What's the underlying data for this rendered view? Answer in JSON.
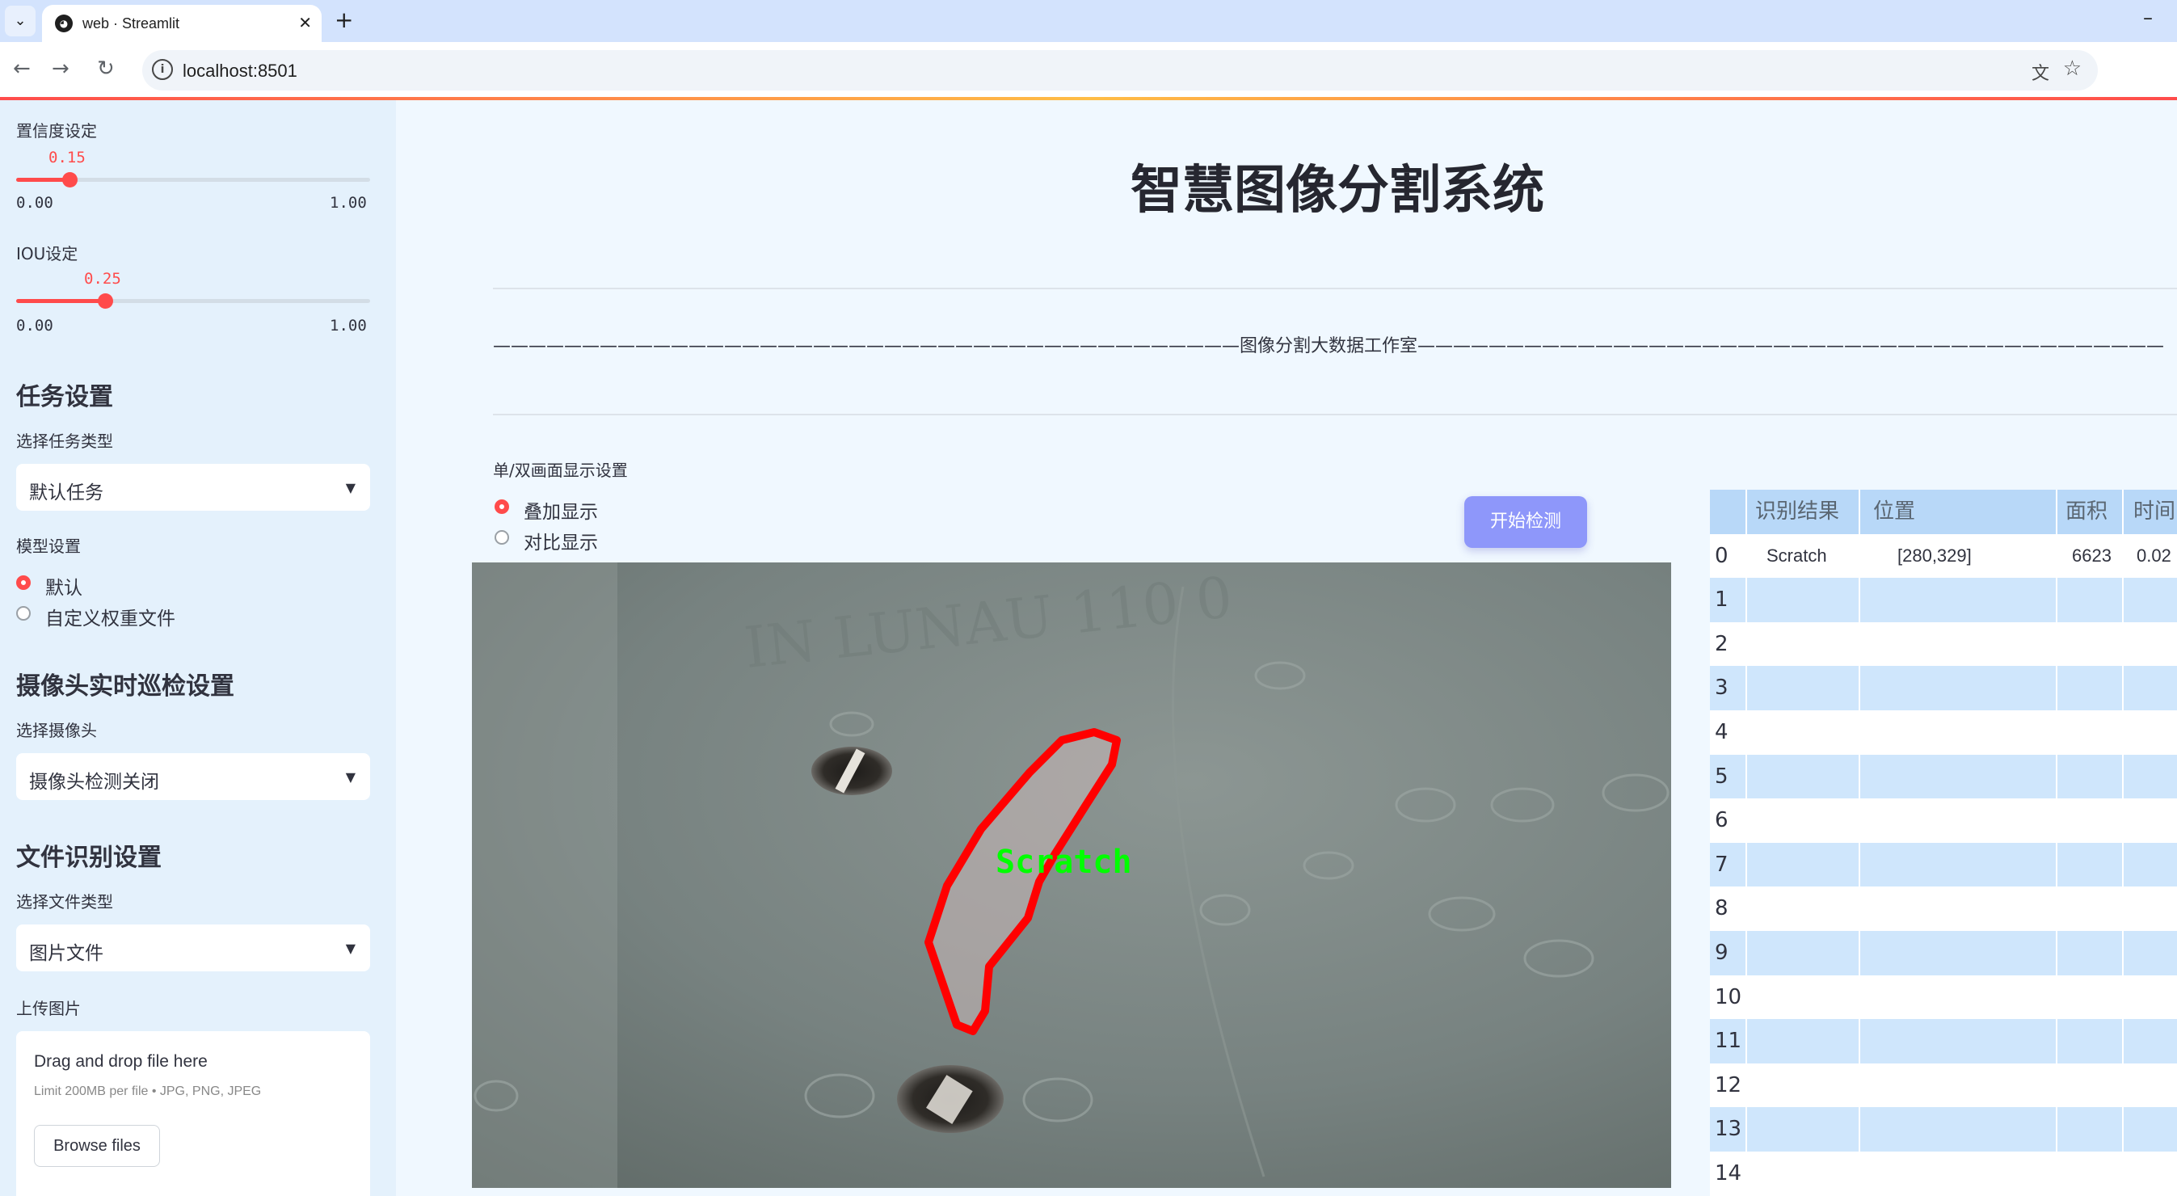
{
  "browser": {
    "tab_title": "web · Streamlit",
    "url": "localhost:8501",
    "new_tab_symbol": "+",
    "minimize_symbol": "–"
  },
  "sidebar": {
    "confidence": {
      "label": "置信度设定",
      "value": 0.15,
      "value_text": "0.15",
      "min_text": "0.00",
      "max_text": "1.00"
    },
    "iou": {
      "label": "IOU设定",
      "value": 0.25,
      "value_text": "0.25",
      "min_text": "0.00",
      "max_text": "1.00"
    },
    "task_section": {
      "heading": "任务设置",
      "select_label": "选择任务类型",
      "selected": "默认任务"
    },
    "model_section": {
      "label": "模型设置",
      "options": [
        "默认",
        "自定义权重文件"
      ],
      "selected_index": 0
    },
    "camera_section": {
      "heading": "摄像头实时巡检设置",
      "select_label": "选择摄像头",
      "selected": "摄像头检测关闭"
    },
    "file_section": {
      "heading": "文件识别设置",
      "select_label": "选择文件类型",
      "selected": "图片文件"
    },
    "upload": {
      "label": "上传图片",
      "drop_text": "Drag and drop file here",
      "limit_text": "Limit 200MB per file • JPG, PNG, JPEG",
      "browse_label": "Browse files"
    }
  },
  "main": {
    "title": "智慧图像分割系统",
    "studio_line": "——————————————————————————————————————————图像分割大数据工作室——————————————————————————————————————————",
    "display_setting": {
      "label": "单/双画面显示设置",
      "options": [
        "叠加显示",
        "对比显示"
      ],
      "selected_index": 0
    },
    "start_button": "开始检测",
    "detection": {
      "label": "Scratch",
      "label_color": "#00ff00",
      "mask_color": "#ff0000"
    }
  },
  "result_table": {
    "columns": [
      "识别结果",
      "位置",
      "面积",
      "时间"
    ],
    "rows": [
      {
        "index": "0",
        "result": "Scratch",
        "position": "[280,329]",
        "area": "6623",
        "time": "0.02"
      },
      {
        "index": "1"
      },
      {
        "index": "2"
      },
      {
        "index": "3"
      },
      {
        "index": "4"
      },
      {
        "index": "5"
      },
      {
        "index": "6"
      },
      {
        "index": "7"
      },
      {
        "index": "8"
      },
      {
        "index": "9"
      },
      {
        "index": "10"
      },
      {
        "index": "11"
      },
      {
        "index": "12"
      },
      {
        "index": "13"
      },
      {
        "index": "14"
      }
    ],
    "header_color": "#b8d8f8",
    "stripe_color": "#cfe6fc"
  }
}
